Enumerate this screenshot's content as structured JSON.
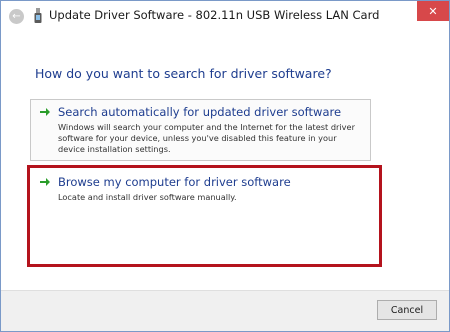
{
  "window": {
    "title": "Update Driver Software - 802.11n USB Wireless LAN Card",
    "close_glyph": "✕",
    "back_glyph": "←"
  },
  "question": "How do you want to search for driver software?",
  "options": [
    {
      "title": "Search automatically for updated driver software",
      "description": "Windows will search your computer and the Internet for the latest driver software for your device, unless you've disabled this feature in your device installation settings.",
      "icon": "green-arrow-icon"
    },
    {
      "title": "Browse my computer for driver software",
      "description": "Locate and install driver software manually.",
      "icon": "green-arrow-icon"
    }
  ],
  "footer": {
    "cancel_label": "Cancel"
  },
  "colors": {
    "link_blue": "#1e3d8f",
    "arrow_green": "#2a9d2a",
    "highlight_red": "#b4131d",
    "close_red": "#d7484a"
  }
}
